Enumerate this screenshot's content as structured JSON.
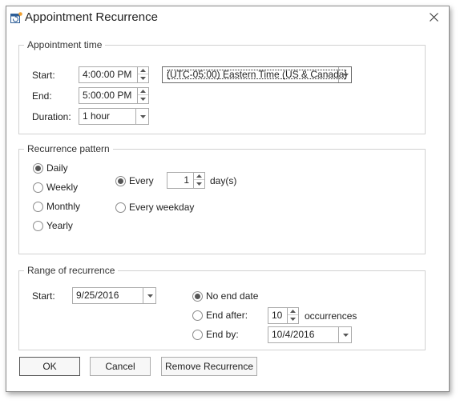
{
  "window": {
    "title": "Appointment Recurrence",
    "icon": "calendar-recurrence-icon"
  },
  "appointment_time": {
    "caption": "Appointment time",
    "start_label": "Start:",
    "start_value": "4:00:00 PM",
    "end_label": "End:",
    "end_value": "5:00:00 PM",
    "duration_label": "Duration:",
    "duration_value": "1 hour",
    "timezone_value": "(UTC-05:00) Eastern Time (US & Canada)"
  },
  "recurrence_pattern": {
    "caption": "Recurrence pattern",
    "types": [
      {
        "label": "Daily",
        "selected": true
      },
      {
        "label": "Weekly",
        "selected": false
      },
      {
        "label": "Monthly",
        "selected": false
      },
      {
        "label": "Yearly",
        "selected": false
      }
    ],
    "every_label": "Every",
    "every_value": "1",
    "days_label": "day(s)",
    "every_weekday_label": "Every weekday"
  },
  "range_of_recurrence": {
    "caption": "Range of recurrence",
    "start_label": "Start:",
    "start_value": "9/25/2016",
    "no_end_label": "No end date",
    "end_after_label": "End after:",
    "end_after_value": "10",
    "occurrences_label": "occurrences",
    "end_by_label": "End by:",
    "end_by_value": "10/4/2016"
  },
  "buttons": {
    "ok": "OK",
    "cancel": "Cancel",
    "remove": "Remove Recurrence"
  },
  "colors": {
    "radio_dot": "#555555",
    "border": "#ababab",
    "group_border": "#d1d1d1"
  }
}
